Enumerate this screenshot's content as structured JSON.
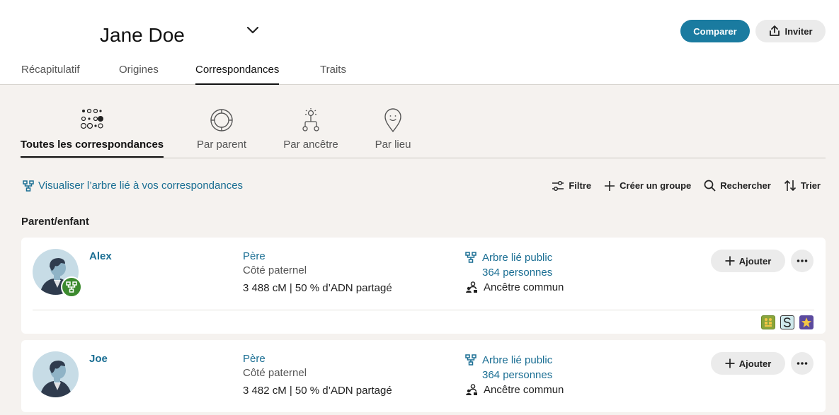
{
  "header": {
    "name": "Jane Doe",
    "compare_label": "Comparer",
    "invite_label": "Inviter"
  },
  "tabs": [
    {
      "label": "Récapitulatif",
      "active": false
    },
    {
      "label": "Origines",
      "active": false
    },
    {
      "label": "Correspondances",
      "active": true
    },
    {
      "label": "Traits",
      "active": false
    }
  ],
  "subtabs": [
    {
      "label": "Toutes les correspondances",
      "icon": "all-matches-icon",
      "active": true
    },
    {
      "label": "Par parent",
      "icon": "parent-circle-icon",
      "active": false
    },
    {
      "label": "Par ancêtre",
      "icon": "ancestor-tree-icon",
      "active": false
    },
    {
      "label": "Par lieu",
      "icon": "location-pin-icon",
      "active": false
    }
  ],
  "viz_link": "Visualiser l’arbre lié à vos correspondances",
  "toolbar": {
    "filter": "Filtre",
    "create_group": "Créer un groupe",
    "search": "Rechercher",
    "sort": "Trier"
  },
  "section_title": "Parent/enfant",
  "matches": [
    {
      "name": "Alex",
      "relationship": "Père",
      "side": "Côté paternel",
      "dna": "3 488 cM | 50 % d’ADN partagé",
      "tree_label": "Arbre lié public",
      "tree_count": "364 personnes",
      "common_ancestor": "Ancêtre commun",
      "add_label": "Ajouter",
      "has_tree_badge": true,
      "group_icons": [
        "people-group-icon",
        "s-letter-icon",
        "star-icon"
      ]
    },
    {
      "name": "Joe",
      "relationship": "Père",
      "side": "Côté paternel",
      "dna": "3 482 cM | 50 % d’ADN partagé",
      "tree_label": "Arbre lié public",
      "tree_count": "364 personnes",
      "common_ancestor": "Ancêtre commun",
      "add_label": "Ajouter",
      "has_tree_badge": false,
      "group_icons": []
    }
  ],
  "colors": {
    "accent": "#1a7ba0",
    "link": "#1a6e93",
    "background": "#f5f2ef",
    "tree_badge": "#3c8a2e"
  }
}
